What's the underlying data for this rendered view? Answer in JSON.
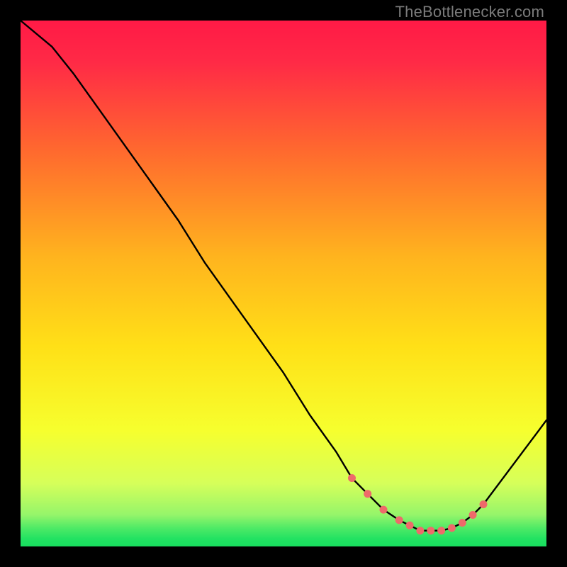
{
  "watermark": "TheBottlenecker.com",
  "chart_data": {
    "type": "line",
    "title": "",
    "xlabel": "",
    "ylabel": "",
    "xlim": [
      0,
      100
    ],
    "ylim": [
      0,
      100
    ],
    "grid": false,
    "background": "red-yellow-green vertical gradient",
    "x": [
      0,
      6,
      10,
      15,
      20,
      25,
      30,
      35,
      40,
      45,
      50,
      55,
      60,
      63,
      66,
      69,
      72,
      74,
      76,
      78,
      80,
      82,
      84,
      86,
      88,
      100
    ],
    "y": [
      100,
      95,
      90,
      83,
      76,
      69,
      62,
      54,
      47,
      40,
      33,
      25,
      18,
      13,
      10,
      7,
      5,
      4,
      3,
      3,
      3,
      3.5,
      4.5,
      6,
      8,
      24
    ],
    "curve_markers_x": [
      63,
      66,
      69,
      72,
      74,
      76,
      78,
      80,
      82,
      84,
      86,
      88
    ],
    "curve_markers_y": [
      13,
      10,
      7,
      5,
      4,
      3,
      3,
      3,
      3.5,
      4.5,
      6,
      8
    ],
    "note": "Values estimated from pixel positions; x and y in percent of axis range."
  },
  "colors": {
    "gradient_top": "#ff1a46",
    "gradient_mid": "#ffd000",
    "gradient_green": "#2fe262",
    "curve": "#000000",
    "marker": "#ee6a6a",
    "watermark": "#7b7b7b"
  }
}
